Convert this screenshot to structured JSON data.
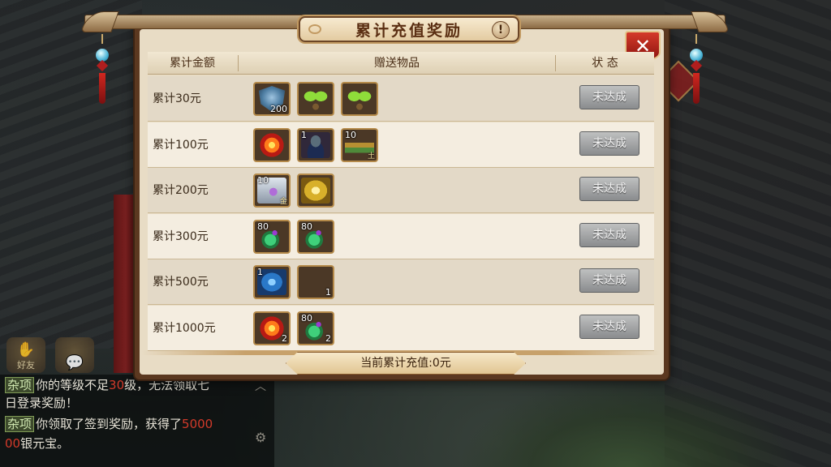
{
  "dialog": {
    "title": "累计充值奖励",
    "help_symbol": "!",
    "close_symbol": "✕"
  },
  "table": {
    "headers": {
      "amount": "累计金额",
      "items": "赠送物品",
      "status": "状 态"
    },
    "rows": [
      {
        "label": "累计30元",
        "status": "未达成",
        "items": [
          {
            "icon": "shield-icon",
            "count_br": "200",
            "count_tl": ""
          },
          {
            "icon": "sprout-icon",
            "count_br": "",
            "count_tl": ""
          },
          {
            "icon": "sprout-icon",
            "count_br": "",
            "count_tl": ""
          }
        ]
      },
      {
        "label": "累计100元",
        "status": "未达成",
        "items": [
          {
            "icon": "flower-icon",
            "count_br": "",
            "count_tl": ""
          },
          {
            "icon": "general-portrait-icon",
            "count_br": "",
            "count_tl": "1"
          },
          {
            "icon": "mount-icon",
            "count_br": "",
            "count_tl": "10",
            "mark": "土"
          }
        ]
      },
      {
        "label": "累计200元",
        "status": "未达成",
        "items": [
          {
            "icon": "chest-icon",
            "count_br": "",
            "count_tl": "10",
            "mark": "金"
          },
          {
            "icon": "golden-armor-icon",
            "count_br": "",
            "count_tl": ""
          }
        ]
      },
      {
        "label": "累计300元",
        "status": "未达成",
        "items": [
          {
            "icon": "gourd-icon",
            "count_br": "",
            "count_tl": "80"
          },
          {
            "icon": "gourd-icon",
            "count_br": "",
            "count_tl": "80"
          }
        ]
      },
      {
        "label": "累计500元",
        "status": "未达成",
        "items": [
          {
            "icon": "dragon-icon",
            "count_br": "",
            "count_tl": "1"
          },
          {
            "icon": "empty-slot-icon",
            "count_br": "1",
            "count_tl": ""
          }
        ]
      },
      {
        "label": "累计1000元",
        "status": "未达成",
        "items": [
          {
            "icon": "flower-icon",
            "count_br": "2",
            "count_tl": ""
          },
          {
            "icon": "gourd-icon",
            "count_br": "2",
            "count_tl": "80"
          }
        ]
      }
    ]
  },
  "total": {
    "text": "当前累计充值:0元"
  },
  "chat": {
    "friend_label": "好友",
    "lines": [
      {
        "tag": "杂项",
        "pre": "你的等级不足",
        "hl": "30",
        "post": "级，无法领取七"
      },
      {
        "tag": "",
        "pre": "日登录奖励！",
        "hl": "",
        "post": ""
      },
      {
        "tag": "杂项",
        "pre": "你领取了签到奖励，获得了",
        "hl": "5000",
        "post": ""
      },
      {
        "tag": "",
        "pre": "",
        "hl": "00",
        "post": "银元宝。"
      }
    ]
  }
}
